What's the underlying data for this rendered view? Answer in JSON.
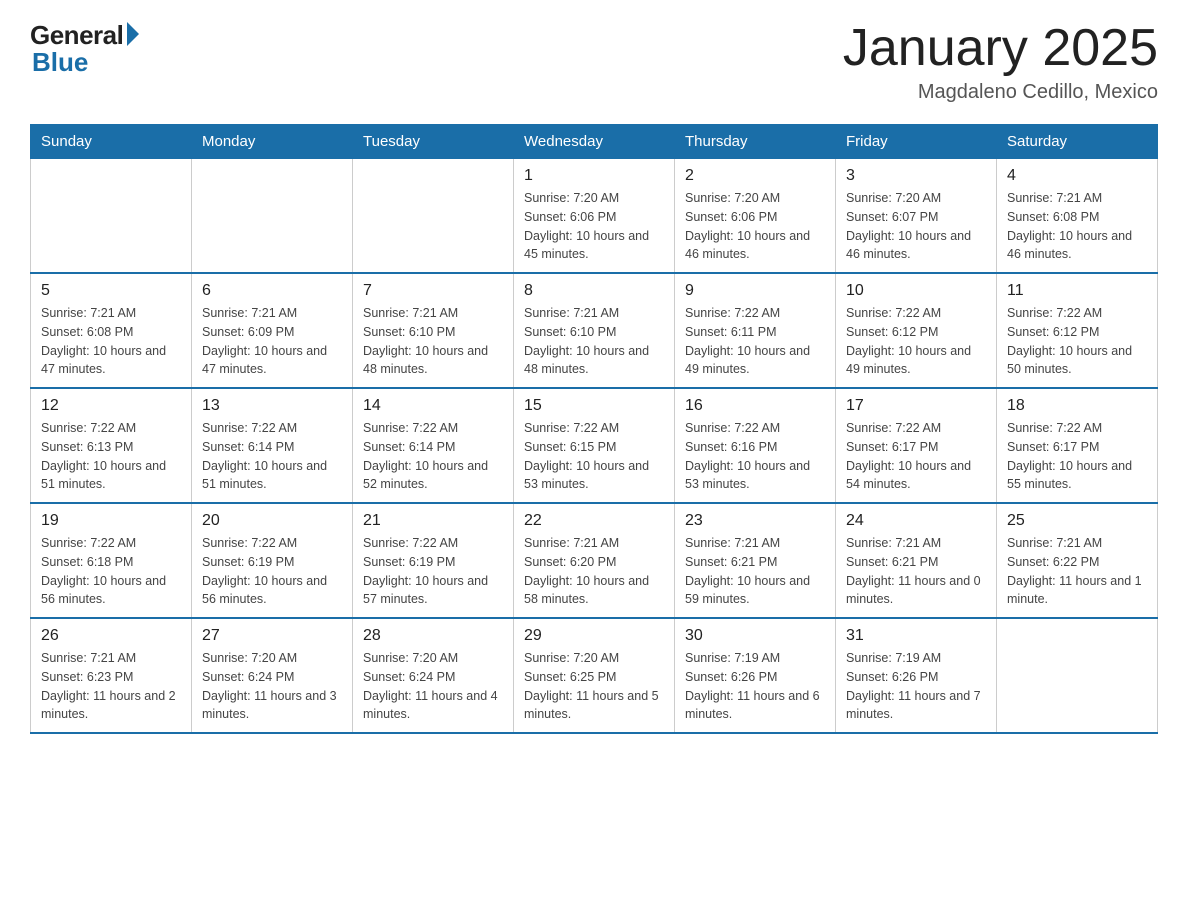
{
  "logo": {
    "general": "General",
    "blue": "Blue"
  },
  "title": "January 2025",
  "location": "Magdaleno Cedillo, Mexico",
  "weekdays": [
    "Sunday",
    "Monday",
    "Tuesday",
    "Wednesday",
    "Thursday",
    "Friday",
    "Saturday"
  ],
  "weeks": [
    [
      {
        "day": "",
        "info": ""
      },
      {
        "day": "",
        "info": ""
      },
      {
        "day": "",
        "info": ""
      },
      {
        "day": "1",
        "info": "Sunrise: 7:20 AM\nSunset: 6:06 PM\nDaylight: 10 hours and 45 minutes."
      },
      {
        "day": "2",
        "info": "Sunrise: 7:20 AM\nSunset: 6:06 PM\nDaylight: 10 hours and 46 minutes."
      },
      {
        "day": "3",
        "info": "Sunrise: 7:20 AM\nSunset: 6:07 PM\nDaylight: 10 hours and 46 minutes."
      },
      {
        "day": "4",
        "info": "Sunrise: 7:21 AM\nSunset: 6:08 PM\nDaylight: 10 hours and 46 minutes."
      }
    ],
    [
      {
        "day": "5",
        "info": "Sunrise: 7:21 AM\nSunset: 6:08 PM\nDaylight: 10 hours and 47 minutes."
      },
      {
        "day": "6",
        "info": "Sunrise: 7:21 AM\nSunset: 6:09 PM\nDaylight: 10 hours and 47 minutes."
      },
      {
        "day": "7",
        "info": "Sunrise: 7:21 AM\nSunset: 6:10 PM\nDaylight: 10 hours and 48 minutes."
      },
      {
        "day": "8",
        "info": "Sunrise: 7:21 AM\nSunset: 6:10 PM\nDaylight: 10 hours and 48 minutes."
      },
      {
        "day": "9",
        "info": "Sunrise: 7:22 AM\nSunset: 6:11 PM\nDaylight: 10 hours and 49 minutes."
      },
      {
        "day": "10",
        "info": "Sunrise: 7:22 AM\nSunset: 6:12 PM\nDaylight: 10 hours and 49 minutes."
      },
      {
        "day": "11",
        "info": "Sunrise: 7:22 AM\nSunset: 6:12 PM\nDaylight: 10 hours and 50 minutes."
      }
    ],
    [
      {
        "day": "12",
        "info": "Sunrise: 7:22 AM\nSunset: 6:13 PM\nDaylight: 10 hours and 51 minutes."
      },
      {
        "day": "13",
        "info": "Sunrise: 7:22 AM\nSunset: 6:14 PM\nDaylight: 10 hours and 51 minutes."
      },
      {
        "day": "14",
        "info": "Sunrise: 7:22 AM\nSunset: 6:14 PM\nDaylight: 10 hours and 52 minutes."
      },
      {
        "day": "15",
        "info": "Sunrise: 7:22 AM\nSunset: 6:15 PM\nDaylight: 10 hours and 53 minutes."
      },
      {
        "day": "16",
        "info": "Sunrise: 7:22 AM\nSunset: 6:16 PM\nDaylight: 10 hours and 53 minutes."
      },
      {
        "day": "17",
        "info": "Sunrise: 7:22 AM\nSunset: 6:17 PM\nDaylight: 10 hours and 54 minutes."
      },
      {
        "day": "18",
        "info": "Sunrise: 7:22 AM\nSunset: 6:17 PM\nDaylight: 10 hours and 55 minutes."
      }
    ],
    [
      {
        "day": "19",
        "info": "Sunrise: 7:22 AM\nSunset: 6:18 PM\nDaylight: 10 hours and 56 minutes."
      },
      {
        "day": "20",
        "info": "Sunrise: 7:22 AM\nSunset: 6:19 PM\nDaylight: 10 hours and 56 minutes."
      },
      {
        "day": "21",
        "info": "Sunrise: 7:22 AM\nSunset: 6:19 PM\nDaylight: 10 hours and 57 minutes."
      },
      {
        "day": "22",
        "info": "Sunrise: 7:21 AM\nSunset: 6:20 PM\nDaylight: 10 hours and 58 minutes."
      },
      {
        "day": "23",
        "info": "Sunrise: 7:21 AM\nSunset: 6:21 PM\nDaylight: 10 hours and 59 minutes."
      },
      {
        "day": "24",
        "info": "Sunrise: 7:21 AM\nSunset: 6:21 PM\nDaylight: 11 hours and 0 minutes."
      },
      {
        "day": "25",
        "info": "Sunrise: 7:21 AM\nSunset: 6:22 PM\nDaylight: 11 hours and 1 minute."
      }
    ],
    [
      {
        "day": "26",
        "info": "Sunrise: 7:21 AM\nSunset: 6:23 PM\nDaylight: 11 hours and 2 minutes."
      },
      {
        "day": "27",
        "info": "Sunrise: 7:20 AM\nSunset: 6:24 PM\nDaylight: 11 hours and 3 minutes."
      },
      {
        "day": "28",
        "info": "Sunrise: 7:20 AM\nSunset: 6:24 PM\nDaylight: 11 hours and 4 minutes."
      },
      {
        "day": "29",
        "info": "Sunrise: 7:20 AM\nSunset: 6:25 PM\nDaylight: 11 hours and 5 minutes."
      },
      {
        "day": "30",
        "info": "Sunrise: 7:19 AM\nSunset: 6:26 PM\nDaylight: 11 hours and 6 minutes."
      },
      {
        "day": "31",
        "info": "Sunrise: 7:19 AM\nSunset: 6:26 PM\nDaylight: 11 hours and 7 minutes."
      },
      {
        "day": "",
        "info": ""
      }
    ]
  ]
}
